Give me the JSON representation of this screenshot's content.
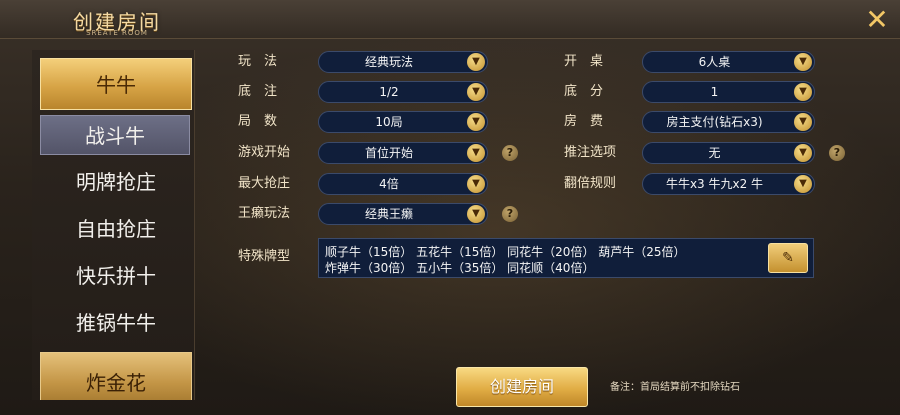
{
  "header": {
    "title": "创建房间",
    "subtitle": "SREATE ROOM",
    "close_icon": "close-icon"
  },
  "sidebar": {
    "items": [
      {
        "label": "牛牛",
        "type": "category"
      },
      {
        "label": "战斗牛",
        "type": "sub",
        "active": true
      },
      {
        "label": "明牌抢庄",
        "type": "sub"
      },
      {
        "label": "自由抢庄",
        "type": "sub"
      },
      {
        "label": "快乐拼十",
        "type": "sub"
      },
      {
        "label": "推锅牛牛",
        "type": "sub"
      },
      {
        "label": "炸金花",
        "type": "category"
      }
    ]
  },
  "settings": {
    "left": [
      {
        "label": "玩　法",
        "value": "经典玩法",
        "help": false
      },
      {
        "label": "底　注",
        "value": "1/2",
        "help": false
      },
      {
        "label": "局　数",
        "value": "10局",
        "help": false
      },
      {
        "label": "游戏开始",
        "value": "首位开始",
        "help": true
      },
      {
        "label": "最大抢庄",
        "value": "4倍",
        "help": false
      },
      {
        "label": "王癞玩法",
        "value": "经典王癞",
        "help": true
      }
    ],
    "right": [
      {
        "label": "开　桌",
        "value": "6人桌",
        "help": false
      },
      {
        "label": "底　分",
        "value": "1",
        "help": false
      },
      {
        "label": "房　费",
        "value": "房主支付(钻石x3)",
        "help": false
      },
      {
        "label": "推注选项",
        "value": "无",
        "help": true
      },
      {
        "label": "翻倍规则",
        "value": "牛牛x3 牛九x2 牛",
        "help": false
      }
    ]
  },
  "special": {
    "label": "特殊牌型",
    "line1": "顺子牛（15倍） 五花牛（15倍） 同花牛（20倍） 葫芦牛（25倍）",
    "line2": "炸弹牛（30倍） 五小牛（35倍） 同花顺（40倍）",
    "edit_icon": "pencil-icon"
  },
  "footer": {
    "create_label": "创建房间",
    "note": "备注：首局结算前不扣除钻石"
  },
  "colors": {
    "gold": "#d7a446",
    "select_bg": "#101e3a",
    "active_sub": "#6d6f86"
  }
}
